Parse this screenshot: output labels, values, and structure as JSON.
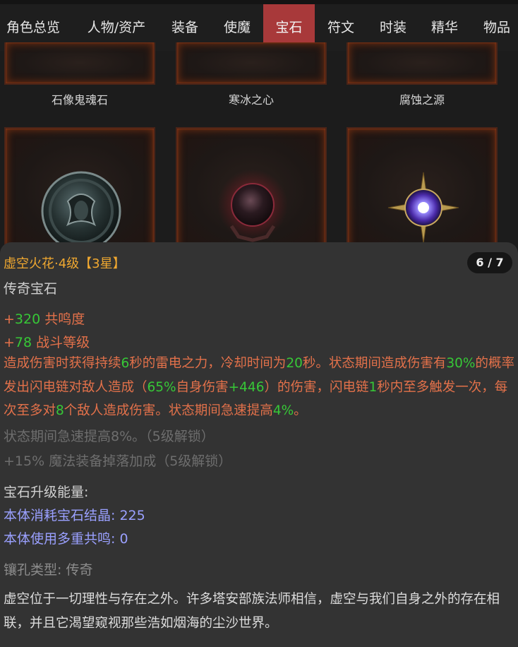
{
  "nav": {
    "tabs": [
      "角色总览",
      "人物/资产",
      "装备",
      "使魔",
      "宝石",
      "符文",
      "时装",
      "精华",
      "物品"
    ],
    "active_index": 4
  },
  "gems": {
    "row1_names": [
      "石像鬼魂石",
      "寒冰之心",
      "腐蚀之源"
    ]
  },
  "detail": {
    "title": "虚空火花·4级【3星】",
    "type": "传奇宝石",
    "counter": "6 / 7",
    "stats": [
      {
        "plus": "+",
        "value": "320",
        "label": " 共鸣度"
      },
      {
        "plus": "+",
        "value": "78",
        "label": " 战斗等级"
      }
    ],
    "effect_parts": [
      {
        "t": "造成伤害时获得持续",
        "c": "stat"
      },
      {
        "t": "6",
        "c": "num"
      },
      {
        "t": "秒的雷电之力，冷却时间为",
        "c": "stat"
      },
      {
        "t": "20",
        "c": "num"
      },
      {
        "t": "秒。状态期间造成伤害有",
        "c": "stat"
      },
      {
        "t": "30%",
        "c": "num"
      },
      {
        "t": "的概率发出闪电链对敌人造成（",
        "c": "stat"
      },
      {
        "t": "65%",
        "c": "num"
      },
      {
        "t": "自身伤害",
        "c": "stat"
      },
      {
        "t": "+446",
        "c": "num"
      },
      {
        "t": "）的伤害，闪电链",
        "c": "stat"
      },
      {
        "t": "1",
        "c": "num"
      },
      {
        "t": "秒内至多触发一次，每次至多对",
        "c": "stat"
      },
      {
        "t": "8",
        "c": "num"
      },
      {
        "t": "个敌人造成伤害。状态期间急速提高",
        "c": "stat"
      },
      {
        "t": "4%",
        "c": "num"
      },
      {
        "t": "。",
        "c": "stat"
      }
    ],
    "locked": [
      "状态期间急速提高8%。（5级解锁）",
      "+15% 魔法装备掉落加成（5级解锁）"
    ],
    "upgrade_title": "宝石升级能量:",
    "upgrade_cost": "本体消耗宝石结晶:  225",
    "upgrade_resonance": "本体使用多重共鸣: 0",
    "socket_type": "镶孔类型: 传奇",
    "lore": "虚空位于一切理性与存在之外。许多塔安部族法师相信，虚空与我们自身之外的存在相联，并且它渴望窥视那些浩如烟海的尘沙世界。"
  },
  "colors": {
    "active_tab": "#a8393a",
    "title": "#f0a830",
    "stat_text": "#e3714a",
    "stat_number": "#37c837",
    "locked_text": "#6e6e6e",
    "upgrade_text": "#9aa0ff"
  },
  "icons": [
    "gargoyle-soulstone-icon",
    "frozen-heart-icon",
    "void-spark-icon",
    "blood-orb-icon",
    "corrosion-source-icon"
  ]
}
